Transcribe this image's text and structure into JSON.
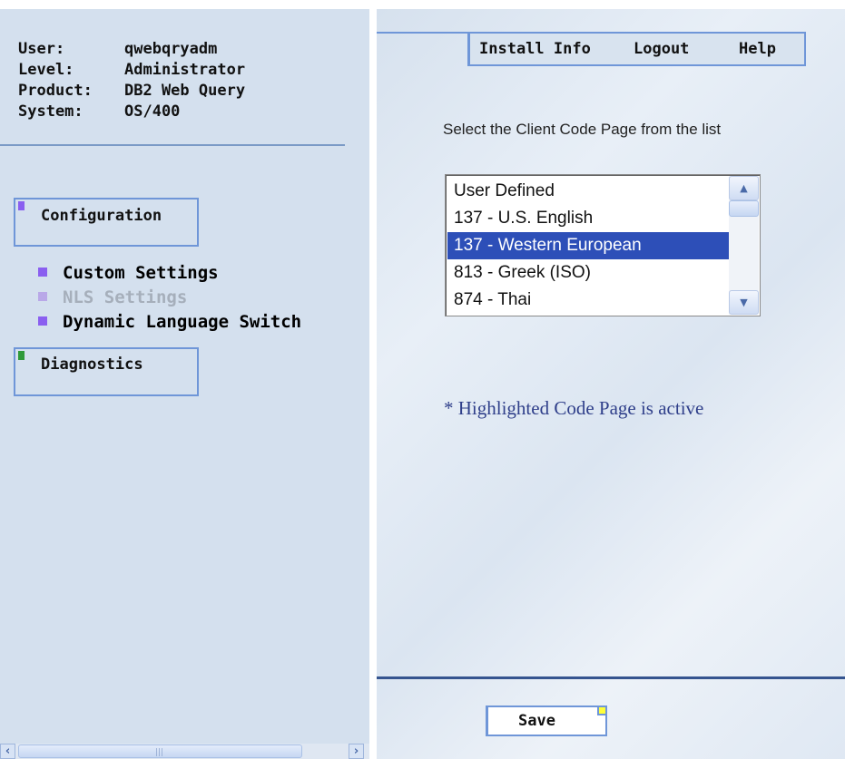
{
  "user_info": {
    "rows": [
      {
        "key": "User:",
        "value": "qwebqryadm"
      },
      {
        "key": "Level:",
        "value": "Administrator"
      },
      {
        "key": "Product:",
        "value": "DB2 Web Query"
      },
      {
        "key": "System:",
        "value": "OS/400"
      }
    ]
  },
  "sidebar": {
    "configuration_label": "Configuration",
    "items": [
      {
        "label": "Custom Settings",
        "enabled": true
      },
      {
        "label": "NLS Settings",
        "enabled": false
      },
      {
        "label": "Dynamic Language Switch",
        "enabled": true
      }
    ],
    "diagnostics_label": "Diagnostics",
    "configuration_marker_color": "#8a5ff0",
    "diagnostics_marker_color": "#2f9a3a"
  },
  "menu": {
    "install_info": "Install Info",
    "logout": "Logout",
    "help": "Help"
  },
  "main": {
    "select_label": "Select the Client Code Page from the list",
    "code_pages": [
      {
        "label": "User Defined",
        "selected": false
      },
      {
        "label": "137 - U.S. English",
        "selected": false
      },
      {
        "label": "137 - Western European",
        "selected": true
      },
      {
        "label": "813 - Greek (ISO)",
        "selected": false
      },
      {
        "label": "874 - Thai",
        "selected": false
      }
    ],
    "note": "* Highlighted Code Page is active",
    "save_label": "Save"
  },
  "icons": {
    "scroll_left": "‹",
    "scroll_right": "›",
    "scroll_up": "▲",
    "scroll_down": "▼",
    "grip": "|||"
  },
  "colors": {
    "accent_border": "#6f96d8",
    "selection": "#2d4fb8",
    "note_text": "#2f3f8a"
  }
}
